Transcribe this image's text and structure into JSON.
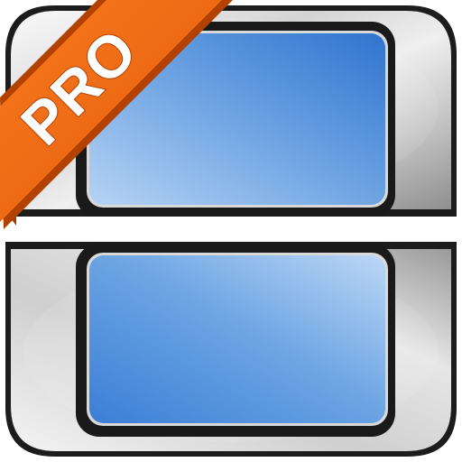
{
  "app_icon": {
    "badge": {
      "label": "PRO"
    },
    "colors": {
      "metal_light": "#f2f2f2",
      "metal_mid": "#c9c9c9",
      "metal_dark": "#8a8a8a",
      "frame_dark": "#1a1a1a",
      "screen_blue_light": "#a9cbf2",
      "screen_blue": "#5a97dd",
      "screen_blue_deep": "#2c72cf",
      "ribbon_orange": "#f26a12",
      "ribbon_dark": "#b34100",
      "hinge_gap": "#ffffff"
    },
    "icons": [
      "dual-screen-console-icon",
      "pro-ribbon-badge"
    ]
  }
}
